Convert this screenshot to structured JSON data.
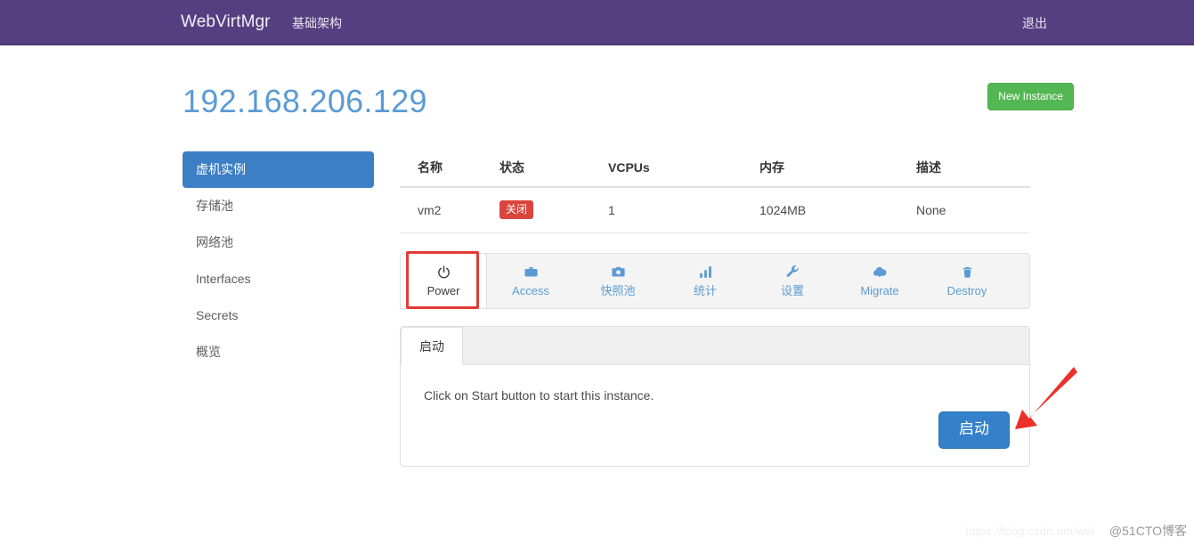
{
  "navbar": {
    "brand": "WebVirtMgr",
    "menu": [
      {
        "label": "基础架构",
        "name": "nav-infrastructure"
      }
    ],
    "logout_label": "退出",
    "background_color": "#553f80"
  },
  "header": {
    "title": "192.168.206.129",
    "title_color": "#5b9bd5",
    "new_instance_label": "New Instance",
    "new_instance_color": "#53b853"
  },
  "sidebar": {
    "items": [
      {
        "label": "虚机实例",
        "active": true
      },
      {
        "label": "存储池",
        "active": false
      },
      {
        "label": "网络池",
        "active": false
      },
      {
        "label": "Interfaces",
        "active": false
      },
      {
        "label": "Secrets",
        "active": false
      },
      {
        "label": "概览",
        "active": false
      }
    ],
    "active_color": "#3d7fc4"
  },
  "table": {
    "columns": [
      "名称",
      "状态",
      "VCPUs",
      "内存",
      "描述"
    ],
    "rows": [
      {
        "name": "vm2",
        "state": "关闭",
        "state_color": "#d9453c",
        "vcpus": "1",
        "memory": "1024MB",
        "description": "None"
      }
    ]
  },
  "toolbar": {
    "items": [
      {
        "label": "Power",
        "icon": "power-icon",
        "active": true
      },
      {
        "label": "Access",
        "icon": "briefcase-icon",
        "active": false
      },
      {
        "label": "快照池",
        "icon": "camera-icon",
        "active": false
      },
      {
        "label": "统计",
        "icon": "bar-chart-icon",
        "active": false
      },
      {
        "label": "设置",
        "icon": "wrench-icon",
        "active": false
      },
      {
        "label": "Migrate",
        "icon": "cloud-upload-icon",
        "active": false
      },
      {
        "label": "Destroy",
        "icon": "trash-icon",
        "active": false
      }
    ],
    "link_color": "#5b9bd5",
    "highlight_color": "#e23b38"
  },
  "panel": {
    "tabs": [
      {
        "label": "启动",
        "active": true
      }
    ],
    "body_text": "Click on Start button to start this instance.",
    "start_button_label": "启动",
    "start_button_color": "#3581c9"
  },
  "annotations": {
    "arrow_color": "#ee2f2a"
  },
  "watermarks": {
    "url": "https://blog.csdn.net/wei",
    "brand": "@51CTO博客"
  }
}
